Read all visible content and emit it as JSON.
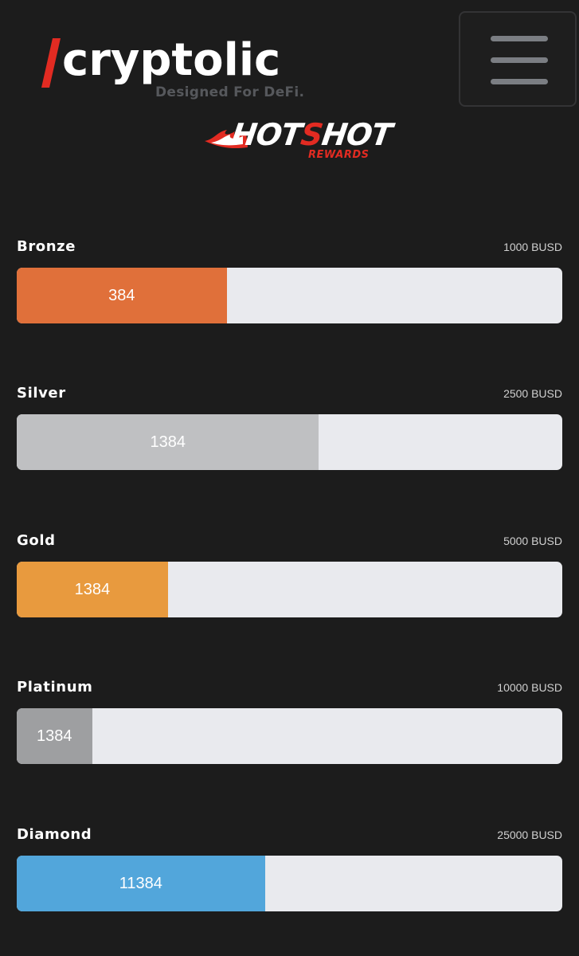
{
  "header": {
    "brand_slash": "/",
    "brand_name": "cryptolic",
    "brand_tagline": "Designed For DeFi.",
    "menu_icon": "hamburger-menu-icon"
  },
  "promo": {
    "title_white_1": "HOT",
    "title_red": "S",
    "title_white_2": "HOT",
    "subtitle": "REWARDS",
    "icon": "flame-icon"
  },
  "colors": {
    "background": "#1c1c1c",
    "brand_red": "#e22b22",
    "track": "#e9eaee"
  },
  "tiers": [
    {
      "name": "Bronze",
      "goal": "1000 BUSD",
      "value": "384",
      "progress": 0.385,
      "color": "#e0703a"
    },
    {
      "name": "Silver",
      "goal": "2500 BUSD",
      "value": "1384",
      "progress": 0.554,
      "color": "#bfc0c2"
    },
    {
      "name": "Gold",
      "goal": "5000 BUSD",
      "value": "1384",
      "progress": 0.277,
      "color": "#e89a3e"
    },
    {
      "name": "Platinum",
      "goal": "10000 BUSD",
      "value": "1384",
      "progress": 0.138,
      "color": "#9e9fa1"
    },
    {
      "name": "Diamond",
      "goal": "25000 BUSD",
      "value": "11384",
      "progress": 0.455,
      "color": "#52a6db"
    }
  ]
}
